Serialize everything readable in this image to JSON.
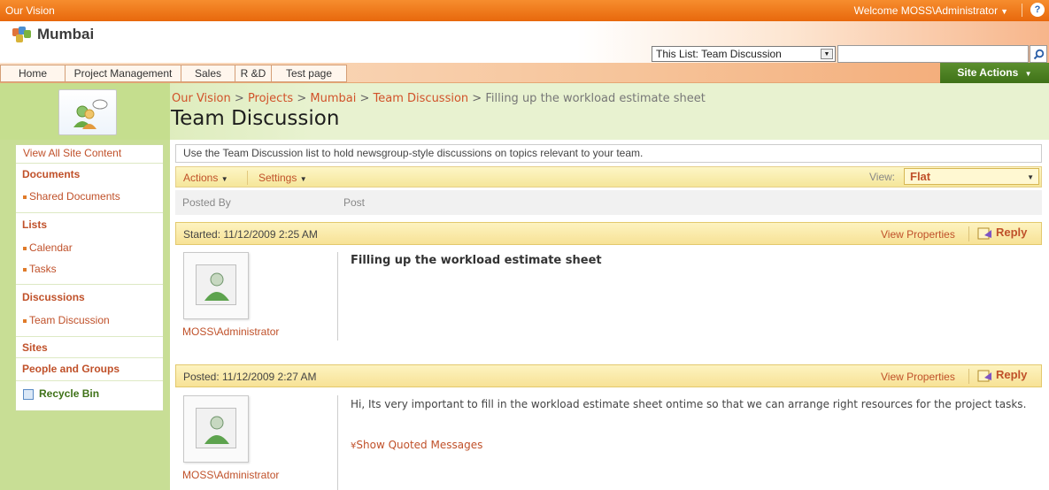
{
  "global": {
    "site_link": "Our Vision",
    "welcome": "Welcome MOSS\\Administrator",
    "help_icon": "?"
  },
  "header": {
    "site_title": "Mumbai",
    "search_scope": "This List: Team Discussion",
    "search_value": ""
  },
  "topnav": {
    "tabs": [
      "Home",
      "Project Management",
      "Sales",
      "R &D",
      "Test page"
    ],
    "site_actions": "Site Actions"
  },
  "breadcrumb": {
    "items": [
      "Our Vision",
      "Projects",
      "Mumbai",
      "Team Discussion"
    ],
    "current": "Filling up the workload estimate sheet",
    "separator": ">"
  },
  "page_title": "Team Discussion",
  "leftnav": {
    "view_all": "View All Site Content",
    "documents": "Documents",
    "shared_documents": "Shared Documents",
    "lists": "Lists",
    "calendar": "Calendar",
    "tasks": "Tasks",
    "discussions": "Discussions",
    "team_discussion": "Team Discussion",
    "sites": "Sites",
    "people_groups": "People and Groups",
    "recycle_bin": "Recycle Bin"
  },
  "list": {
    "description": "Use the Team Discussion list to hold newsgroup-style discussions on topics relevant to your team.",
    "actions": "Actions",
    "settings": "Settings",
    "view_label": "View:",
    "view_value": "Flat",
    "col_posted_by": "Posted By",
    "col_post": "Post"
  },
  "posts": [
    {
      "date": "Started: 11/12/2009 2:25 AM",
      "view_properties": "View Properties",
      "reply": "Reply",
      "author": "MOSS\\Administrator",
      "subject": "Filling up the workload estimate sheet"
    },
    {
      "date": "Posted: 11/12/2009 2:27 AM",
      "view_properties": "View Properties",
      "reply": "Reply",
      "author": "MOSS\\Administrator",
      "body": "Hi, Its very important to fill in the workload estimate sheet ontime so that we can arrange right resources for the project tasks.",
      "show_quoted": "Show Quoted Messages"
    }
  ],
  "colors": {
    "orange_bar": "#e8680c",
    "link": "#c0512a",
    "green": "#3f7218",
    "nav_green": "#c8de95"
  }
}
